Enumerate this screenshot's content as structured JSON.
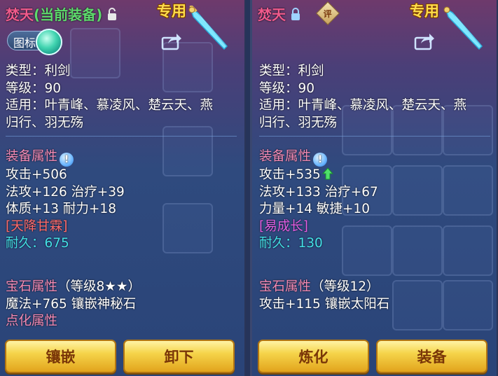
{
  "left": {
    "item_name": "焚天",
    "equip_status": "(当前装备)",
    "exclusive_tag": "专用",
    "toggle_label": "图标",
    "lines": {
      "type": "类型：利剑",
      "level": "等级：90",
      "applicable_1": "适用：叶青峰、慕凌风、楚云天、燕",
      "applicable_2": "归行、羽无殇"
    },
    "equip_attr_head": "装备属性",
    "attrs": {
      "attack": "攻击+506",
      "line2": "法攻+126 治疗+39",
      "line3": "体质+13 耐力+18"
    },
    "special": "[天降甘霖]",
    "durability": "耐久：675",
    "gem_head": "宝石属性",
    "gem_level": "（等级8★★）",
    "gem_detail": "魔法+765 镶嵌神秘石",
    "refine_head": "点化属性",
    "buttons": {
      "inlay": "镶嵌",
      "unequip": "卸下"
    }
  },
  "right": {
    "item_name": "焚天",
    "appraise_badge": "评",
    "exclusive_tag": "专用",
    "lines": {
      "type": "类型：利剑",
      "level": "等级：90",
      "applicable_1": "适用：叶青峰、慕凌风、楚云天、燕",
      "applicable_2": "归行、羽无殇"
    },
    "equip_attr_head": "装备属性",
    "attrs": {
      "attack": "攻击+535",
      "line2": "法攻+133 治疗+67",
      "line3": "力量+14 敏捷+10"
    },
    "special": "[易成长]",
    "durability": "耐久：130",
    "gem_head": "宝石属性",
    "gem_level": "（等级12）",
    "gem_detail": "攻击+115 镶嵌太阳石",
    "buttons": {
      "refine": "炼化",
      "equip": "装备"
    }
  },
  "colors": {
    "name": "#f05a8c",
    "equip_status": "#5dd96c",
    "section": "#f28ab5",
    "durability": "#44e0e8",
    "button": "#f5d44a"
  }
}
